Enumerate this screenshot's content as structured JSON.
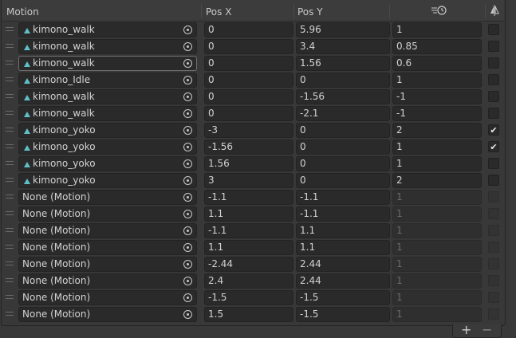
{
  "header": {
    "motion": "Motion",
    "pos_x": "Pos X",
    "pos_y": "Pos Y",
    "speed_icon": "time-scale-icon",
    "mirror_icon": "mirror-icon"
  },
  "rows": [
    {
      "motion": "kimono_walk",
      "clip": true,
      "x": "0",
      "y": "5.96",
      "speed": "1",
      "mirror": false
    },
    {
      "motion": "kimono_walk",
      "clip": true,
      "x": "0",
      "y": "3.4",
      "speed": "0.85",
      "mirror": false
    },
    {
      "motion": "kimono_walk",
      "clip": true,
      "x": "0",
      "y": "1.56",
      "speed": "0.6",
      "mirror": false
    },
    {
      "motion": "kimono_Idle",
      "clip": true,
      "x": "0",
      "y": "0",
      "speed": "1",
      "mirror": false
    },
    {
      "motion": "kimono_walk",
      "clip": true,
      "x": "0",
      "y": "-1.56",
      "speed": "-1",
      "mirror": false
    },
    {
      "motion": "kimono_walk",
      "clip": true,
      "x": "0",
      "y": "-2.1",
      "speed": "-1",
      "mirror": false
    },
    {
      "motion": "kimono_yoko",
      "clip": true,
      "x": "-3",
      "y": "0",
      "speed": "2",
      "mirror": true
    },
    {
      "motion": "kimono_yoko",
      "clip": true,
      "x": "-1.56",
      "y": "0",
      "speed": "1",
      "mirror": true
    },
    {
      "motion": "kimono_yoko",
      "clip": true,
      "x": "1.56",
      "y": "0",
      "speed": "1",
      "mirror": false
    },
    {
      "motion": "kimono_yoko",
      "clip": true,
      "x": "3",
      "y": "0",
      "speed": "2",
      "mirror": false
    },
    {
      "motion": "None (Motion)",
      "clip": false,
      "x": "-1.1",
      "y": "-1.1",
      "speed": "1",
      "mirror": false
    },
    {
      "motion": "None (Motion)",
      "clip": false,
      "x": "1.1",
      "y": "-1.1",
      "speed": "1",
      "mirror": false
    },
    {
      "motion": "None (Motion)",
      "clip": false,
      "x": "-1.1",
      "y": "1.1",
      "speed": "1",
      "mirror": false
    },
    {
      "motion": "None (Motion)",
      "clip": false,
      "x": "1.1",
      "y": "1.1",
      "speed": "1",
      "mirror": false
    },
    {
      "motion": "None (Motion)",
      "clip": false,
      "x": "-2.44",
      "y": "2.44",
      "speed": "1",
      "mirror": false
    },
    {
      "motion": "None (Motion)",
      "clip": false,
      "x": "2.4",
      "y": "2.44",
      "speed": "1",
      "mirror": false
    },
    {
      "motion": "None (Motion)",
      "clip": false,
      "x": "-1.5",
      "y": "-1.5",
      "speed": "1",
      "mirror": false
    },
    {
      "motion": "None (Motion)",
      "clip": false,
      "x": "1.5",
      "y": "-1.5",
      "speed": "1",
      "mirror": false
    }
  ],
  "footer": {
    "add_label": "+",
    "remove_label": "−"
  },
  "colors": {
    "background": "#383838",
    "field": "#2a2a2a",
    "clip_icon": "#5fc0c8"
  }
}
